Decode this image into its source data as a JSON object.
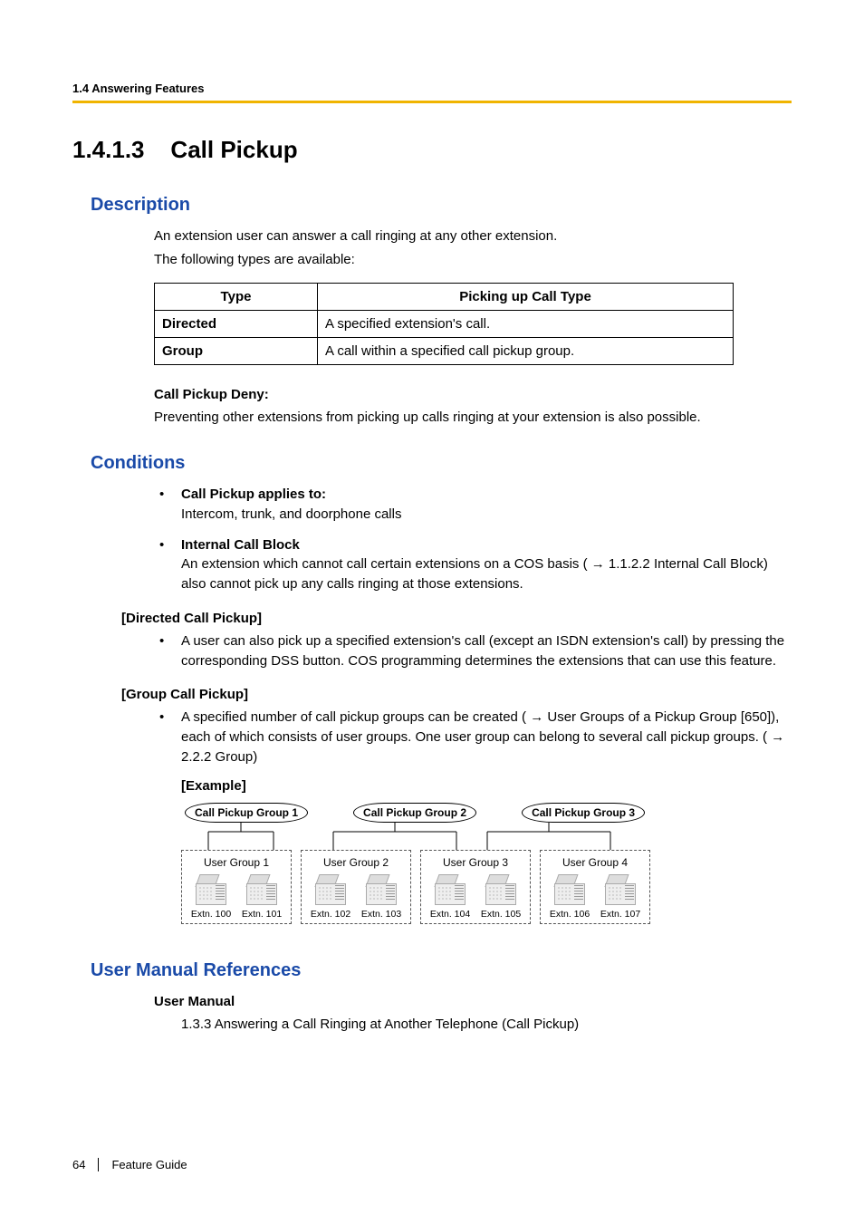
{
  "header": {
    "breadcrumb": "1.4 Answering Features"
  },
  "section": {
    "number": "1.4.1.3",
    "title": "Call Pickup"
  },
  "description": {
    "heading": "Description",
    "line1": "An extension user can answer a call ringing at any other extension.",
    "line2": "The following types are available:",
    "table": {
      "col1": "Type",
      "col2": "Picking up Call Type",
      "rows": [
        {
          "type": "Directed",
          "desc": "A specified extension's call."
        },
        {
          "type": "Group",
          "desc": "A call within a specified call pickup group."
        }
      ]
    },
    "deny_title": "Call Pickup Deny:",
    "deny_text": "Preventing other extensions from picking up calls ringing at your extension is also possible."
  },
  "conditions": {
    "heading": "Conditions",
    "items": [
      {
        "title": "Call Pickup applies to:",
        "text": "Intercom, trunk, and doorphone calls"
      },
      {
        "title": "Internal Call Block",
        "text": "An extension which cannot call certain extensions on a COS basis ( → 1.1.2.2 Internal Call Block) also cannot pick up any calls ringing at those extensions."
      }
    ],
    "directed": {
      "heading": "[Directed Call Pickup]",
      "text": "A user can also pick up a specified extension's call (except an ISDN extension's call) by pressing the corresponding DSS button. COS programming determines the extensions that can use this feature."
    },
    "group": {
      "heading": "[Group Call Pickup]",
      "text": "A specified number of call pickup groups can be created ( → User Groups of a Pickup Group [650]), each of which consists of user groups. One user group can belong to several call pickup groups. ( → 2.2.2 Group)",
      "example_label": "[Example]"
    }
  },
  "diagram": {
    "pickup_groups": [
      "Call Pickup Group 1",
      "Call Pickup Group 2",
      "Call Pickup Group 3"
    ],
    "user_groups": [
      {
        "title": "User Group 1",
        "ext": [
          "Extn. 100",
          "Extn. 101"
        ]
      },
      {
        "title": "User Group 2",
        "ext": [
          "Extn. 102",
          "Extn. 103"
        ]
      },
      {
        "title": "User Group 3",
        "ext": [
          "Extn. 104",
          "Extn. 105"
        ]
      },
      {
        "title": "User Group 4",
        "ext": [
          "Extn. 106",
          "Extn. 107"
        ]
      }
    ]
  },
  "references": {
    "heading": "User Manual References",
    "um_title": "User Manual",
    "um_item": "1.3.3 Answering a Call Ringing at Another Telephone (Call Pickup)"
  },
  "footer": {
    "page": "64",
    "label": "Feature Guide"
  }
}
